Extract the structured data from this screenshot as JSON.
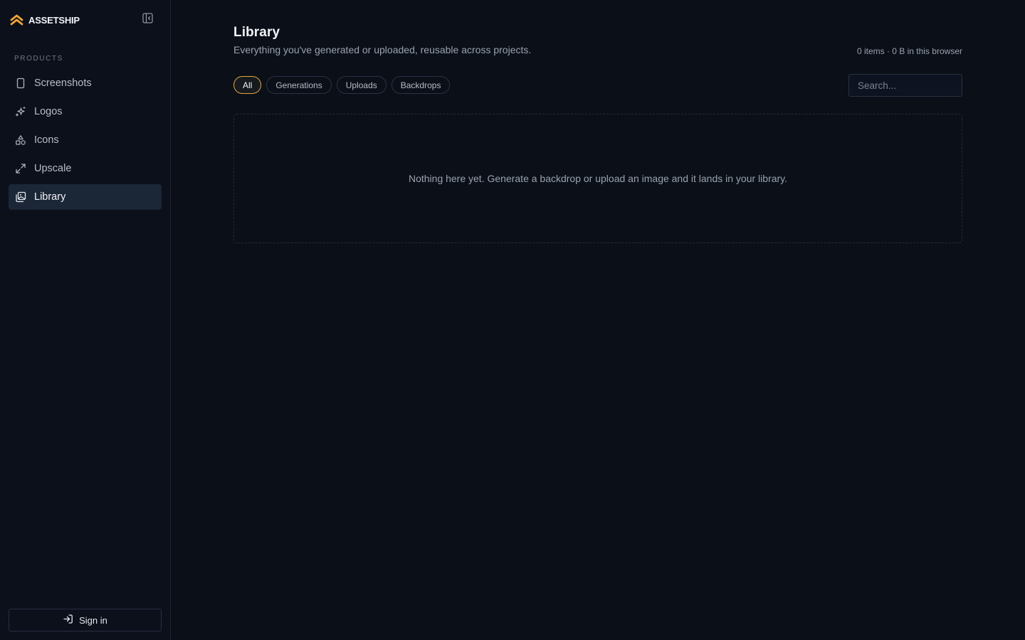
{
  "brand": {
    "name": "ASSETSHIP",
    "logo_icon": "chevrons-up-icon",
    "accent": "#f0a531"
  },
  "sidebar": {
    "section_label": "PRODUCTS",
    "items": [
      {
        "label": "Screenshots",
        "icon": "smartphone-icon",
        "active": false
      },
      {
        "label": "Logos",
        "icon": "sparkles-icon",
        "active": false
      },
      {
        "label": "Icons",
        "icon": "shapes-icon",
        "active": false
      },
      {
        "label": "Upscale",
        "icon": "expand-icon",
        "active": false
      },
      {
        "label": "Library",
        "icon": "images-icon",
        "active": true
      }
    ],
    "signin_label": "Sign in"
  },
  "main": {
    "title": "Library",
    "subtitle": "Everything you've generated or uploaded, reusable across projects.",
    "stats": "0 items · 0 B in this browser",
    "filters": [
      {
        "label": "All",
        "active": true
      },
      {
        "label": "Generations",
        "active": false
      },
      {
        "label": "Uploads",
        "active": false
      },
      {
        "label": "Backdrops",
        "active": false
      }
    ],
    "search": {
      "placeholder": "Search...",
      "value": ""
    },
    "empty_message": "Nothing here yet. Generate a backdrop or upload an image and it lands in your library."
  },
  "colors": {
    "background": "#0a0f18",
    "sidebar_bg": "#0b101a",
    "active_nav_bg": "#1b2636",
    "active_chip_border": "#e0a93a"
  }
}
